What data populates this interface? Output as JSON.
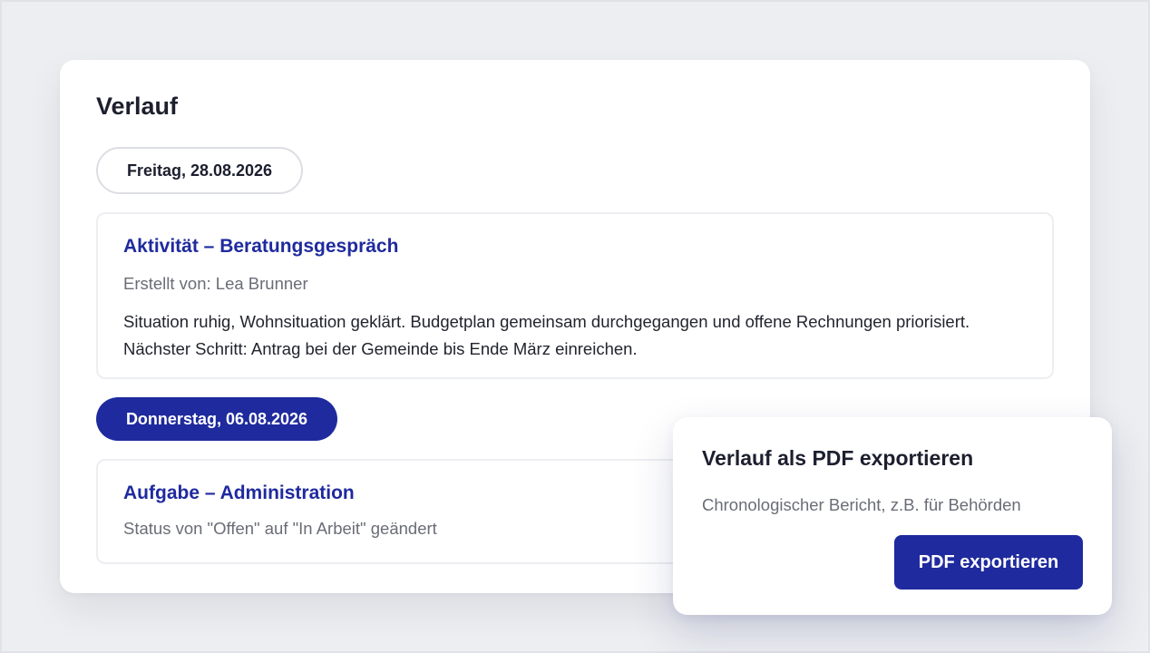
{
  "verlauf": {
    "title": "Verlauf",
    "groups": [
      {
        "date_label": "Freitag, 28.08.2026",
        "selected": false,
        "entries": [
          {
            "title": "Aktivität – Beratungsgespräch",
            "meta": "Erstellt von: Lea Brunner",
            "body": "Situation ruhig, Wohnsituation geklärt. Budgetplan gemeinsam durchgegangen und offene Rechnungen priorisiert. Nächster Schritt: Antrag bei der Gemeinde bis Ende März einreichen."
          }
        ]
      },
      {
        "date_label": "Donnerstag, 06.08.2026",
        "selected": true,
        "entries": [
          {
            "title": "Aufgabe – Administration",
            "meta": "Status von \"Offen\" auf \"In Arbeit\" geändert"
          }
        ]
      }
    ]
  },
  "export_popover": {
    "title": "Verlauf als PDF exportieren",
    "description": "Chronologischer Bericht, z.B. für Behörden",
    "button_label": "PDF exportieren"
  },
  "colors": {
    "accent": "#1f2a9e",
    "background": "#eceef1",
    "card": "#ffffff",
    "text_primary": "#1c1f2e",
    "text_secondary": "#6a6d76"
  }
}
